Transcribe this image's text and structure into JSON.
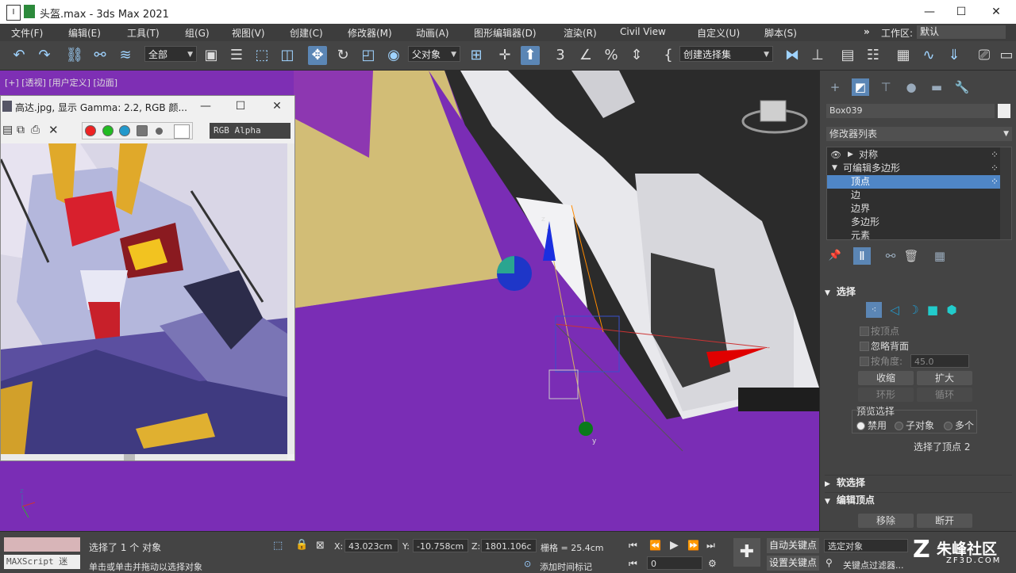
{
  "titlebar": {
    "title": "头盔.max - 3ds Max 2021",
    "app_icon": "I"
  },
  "menu": [
    "文件(F)",
    "编辑(E)",
    "工具(T)",
    "组(G)",
    "视图(V)",
    "创建(C)",
    "修改器(M)",
    "动画(A)",
    "图形编辑器(D)",
    "渲染(R)",
    "Civil View",
    "自定义(U)",
    "脚本(S)"
  ],
  "workspace": {
    "label": "工作区:",
    "value": "默认"
  },
  "toolbar": {
    "filter": "全部",
    "refcoord": "父对象",
    "selset": "创建选择集"
  },
  "viewport": {
    "label": "[+] [透视] [用户定义] [边面]"
  },
  "image_window": {
    "title": "高达.jpg, 显示 Gamma: 2.2, RGB 颜...",
    "channel": "RGB Alpha"
  },
  "command_panel": {
    "object_name": "Box039",
    "modifier_list": "修改器列表",
    "stack": [
      {
        "label": "对称",
        "level": 0
      },
      {
        "label": "可编辑多边形",
        "level": 0
      },
      {
        "label": "顶点",
        "level": 1,
        "selected": true
      },
      {
        "label": "边",
        "level": 1
      },
      {
        "label": "边界",
        "level": 1
      },
      {
        "label": "多边形",
        "level": 1
      },
      {
        "label": "元素",
        "level": 1
      }
    ],
    "selection": {
      "header": "选择",
      "by_vertex": "按顶点",
      "ignore_backfacing": "忽略背面",
      "by_angle": "按角度:",
      "angle_value": "45.0",
      "shrink": "收缩",
      "grow": "扩大",
      "ring": "环形",
      "loop": "循环",
      "preview_label": "预览选择",
      "preview_off": "禁用",
      "preview_sub": "子对象",
      "preview_multi": "多个",
      "status": "选择了顶点 2"
    },
    "soft_selection": "软选择",
    "edit_vertices": {
      "header": "编辑顶点",
      "remove": "移除",
      "break": "断开"
    }
  },
  "statusbar": {
    "maxscript": "MAXScript 迷",
    "selected": "选择了 1 个 对象",
    "hint": "单击或单击并拖动以选择对象",
    "x_label": "X:",
    "x": "43.023cm",
    "y_label": "Y:",
    "y": "-10.758cm",
    "z_label": "Z:",
    "z": "1801.106c",
    "grid": "栅格 = 25.4cm",
    "add_time_tag": "添加时间标记",
    "frame": "0",
    "autokey": "自动关键点",
    "setkey": "设置关键点",
    "selected_obj": "选定对象",
    "key_filters": "关键点过滤器..."
  },
  "watermark": {
    "brand": "朱峰社区",
    "site": "ZF3D.COM"
  }
}
